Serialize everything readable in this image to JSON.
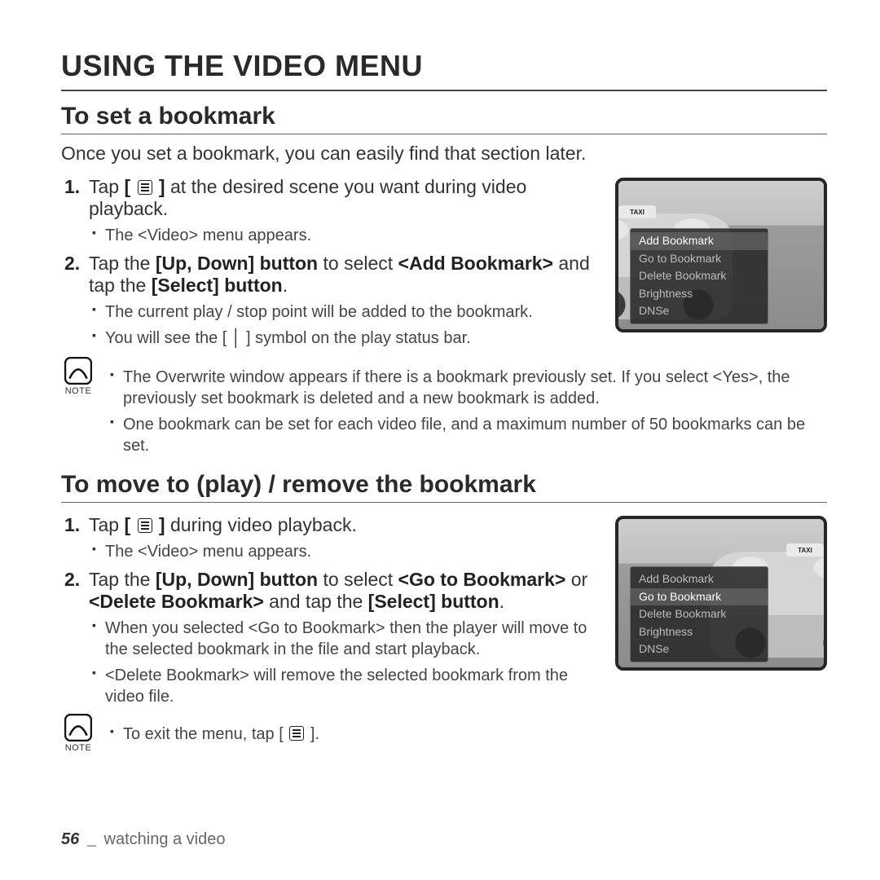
{
  "page_title": "USING THE VIDEO MENU",
  "section1": {
    "heading": "To set a bookmark",
    "intro": "Once you set a bookmark, you can easily find that section later.",
    "step1_before": "Tap ",
    "step1_brackets_open": "[ ",
    "step1_brackets_close": " ]",
    "step1_after": " at the desired scene you want during video playback.",
    "step1_sub": "The <Video> menu appears.",
    "step2_a": "Tap the ",
    "step2_b": "[Up, Down] button",
    "step2_c": " to select ",
    "step2_d": "<Add Bookmark>",
    "step2_e": " and tap the ",
    "step2_f": "[Select] button",
    "step2_g": ".",
    "step2_sub1": "The current play / stop point will be added to the bookmark.",
    "step2_sub2_a": "You will see the [ ",
    "step2_sub2_b": " ] symbol on the play status bar.",
    "vbar": "│"
  },
  "note1": {
    "label": "NOTE",
    "b1": "The Overwrite window appears if there is a bookmark previously set. If you select <Yes>, the previously set bookmark is deleted and a new bookmark is added.",
    "b2": "One bookmark can be set for each video file, and a maximum number of 50 bookmarks can be set."
  },
  "section2": {
    "heading": "To move to (play) / remove the bookmark",
    "step1_before": "Tap ",
    "step1_brackets_open": "[ ",
    "step1_brackets_close": " ]",
    "step1_after": " during video playback.",
    "step1_sub": "The <Video> menu appears.",
    "step2_a": "Tap the ",
    "step2_b": "[Up, Down] button",
    "step2_c": " to select ",
    "step2_d": "<Go to Bookmark>",
    "step2_e": " or ",
    "step2_f": "<Delete Bookmark>",
    "step2_g": " and tap the ",
    "step2_h": "[Select] button",
    "step2_i": ".",
    "step2_sub1": "When you selected <Go to Bookmark> then the player will move to the selected bookmark in the file and start playback.",
    "step2_sub2": "<Delete Bookmark> will remove the selected bookmark from the video file."
  },
  "note2": {
    "label": "NOTE",
    "b1_a": "To exit the menu, tap ",
    "b1_open": "[ ",
    "b1_close": " ]",
    "b1_b": "."
  },
  "illus_menu": {
    "items": [
      "Add Bookmark",
      "Go to Bookmark",
      "Delete Bookmark",
      "Brightness",
      "DNSe"
    ],
    "taxi": "TAXI"
  },
  "footer": {
    "page": "56",
    "bar": "_",
    "section": "watching a video"
  }
}
